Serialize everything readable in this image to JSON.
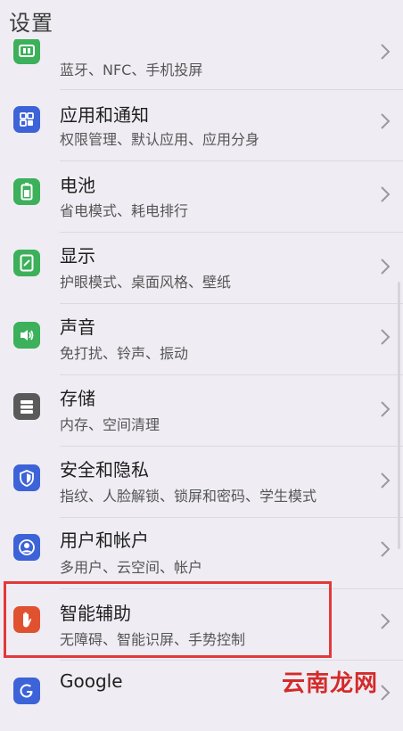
{
  "header": {
    "title": "设置"
  },
  "items": [
    {
      "title": "",
      "subtitle": "蓝牙、NFC、手机投屏",
      "icon": "device-connection-icon",
      "color": "#3cb05a"
    },
    {
      "title": "应用和通知",
      "subtitle": "权限管理、默认应用、应用分身",
      "icon": "apps-icon",
      "color": "#3d63d8"
    },
    {
      "title": "电池",
      "subtitle": "省电模式、耗电排行",
      "icon": "battery-icon",
      "color": "#3cb05a"
    },
    {
      "title": "显示",
      "subtitle": "护眼模式、桌面风格、壁纸",
      "icon": "display-icon",
      "color": "#3cb05a"
    },
    {
      "title": "声音",
      "subtitle": "免打扰、铃声、振动",
      "icon": "sound-icon",
      "color": "#3cb05a"
    },
    {
      "title": "存储",
      "subtitle": "内存、空间清理",
      "icon": "storage-icon",
      "color": "#5a5a5a"
    },
    {
      "title": "安全和隐私",
      "subtitle": "指纹、人脸解锁、锁屏和密码、学生模式",
      "icon": "shield-icon",
      "color": "#3d63d8"
    },
    {
      "title": "用户和帐户",
      "subtitle": "多用户、云空间、帐户",
      "icon": "user-icon",
      "color": "#3d63d8"
    },
    {
      "title": "智能辅助",
      "subtitle": "无障碍、智能识屏、手势控制",
      "icon": "hand-icon",
      "color": "#e0522f"
    },
    {
      "title": "Google",
      "subtitle": "",
      "icon": "google-icon",
      "color": "#3d63d8"
    }
  ],
  "watermark": "云南龙网"
}
